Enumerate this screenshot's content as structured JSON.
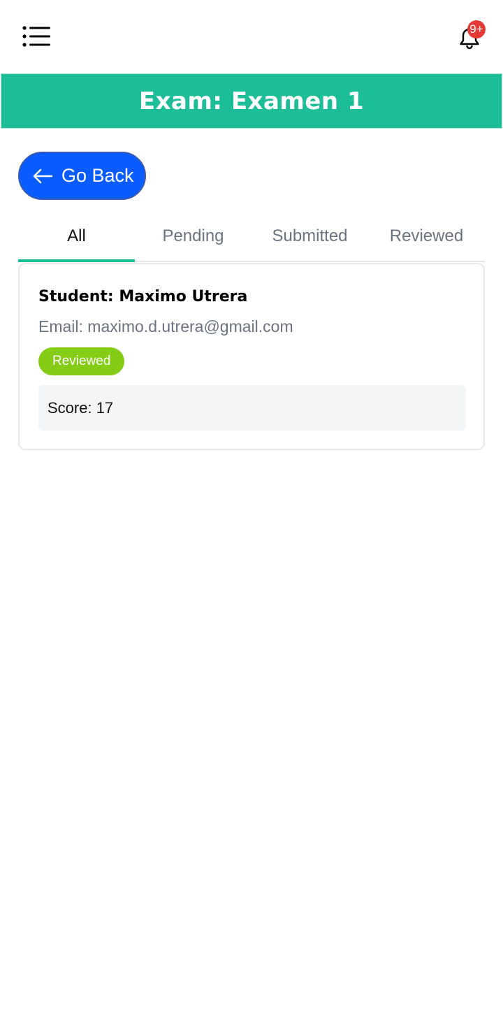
{
  "header": {
    "menu_icon": "list-menu-icon",
    "bell_icon": "bell-icon",
    "notification_count": "9+",
    "badge_color": "#e53935"
  },
  "title_bar": {
    "title": "Exam: Examen 1",
    "background": "#1dbe97"
  },
  "back_button": {
    "label": "Go Back",
    "icon": "arrow-left-icon",
    "color": "#0a5cff"
  },
  "tabs": [
    {
      "label": "All",
      "active": true
    },
    {
      "label": "Pending",
      "active": false
    },
    {
      "label": "Submitted",
      "active": false
    },
    {
      "label": "Reviewed",
      "active": false
    }
  ],
  "submissions": [
    {
      "student": "Student: Maximo Utrera",
      "email": "Email: maximo.d.utrera@gmail.com",
      "status": "Reviewed",
      "status_color": "#84cc16",
      "score": "Score: 17"
    }
  ]
}
